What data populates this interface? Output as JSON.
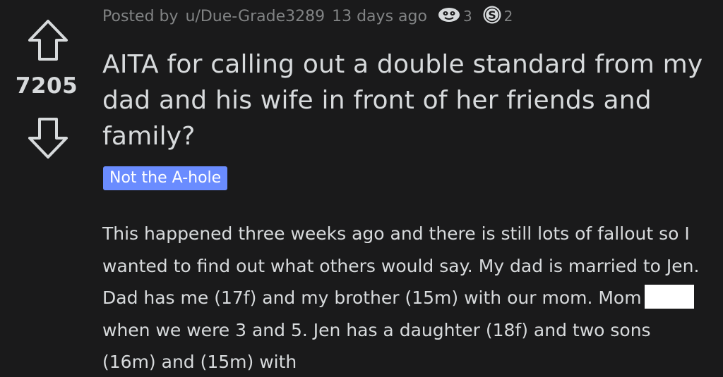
{
  "vote": {
    "upvote_icon": "arrow-up-outline-icon",
    "downvote_icon": "arrow-down-outline-icon",
    "score": "7205"
  },
  "meta": {
    "posted_by": "Posted by",
    "author": "u/Due-Grade3289",
    "age": "13 days ago",
    "awards": [
      {
        "icon": "award-face-icon",
        "count": "3"
      },
      {
        "icon": "award-s-coin-icon",
        "count": "2"
      }
    ]
  },
  "post": {
    "title": "AITA for calling out a double standard from my dad and his wife in front of her friends and family?",
    "flair": "Not the A-hole",
    "body_part1": "This happened three weeks ago and there is still lots of fallout so I wanted to find out what others would say. My dad is married to Jen. Dad has me (17f) and my brother (15m) with our mom. Mom",
    "body_part2": "when we were 3 and 5. Jen has a daughter (18f) and two sons (16m) and (15m) with"
  },
  "colors": {
    "background": "#1a1a1b",
    "text": "#d7dadc",
    "meta": "#818384",
    "flair_bg": "#6a8cff",
    "flair_text": "#ffffff",
    "redaction": "#ffffff"
  }
}
